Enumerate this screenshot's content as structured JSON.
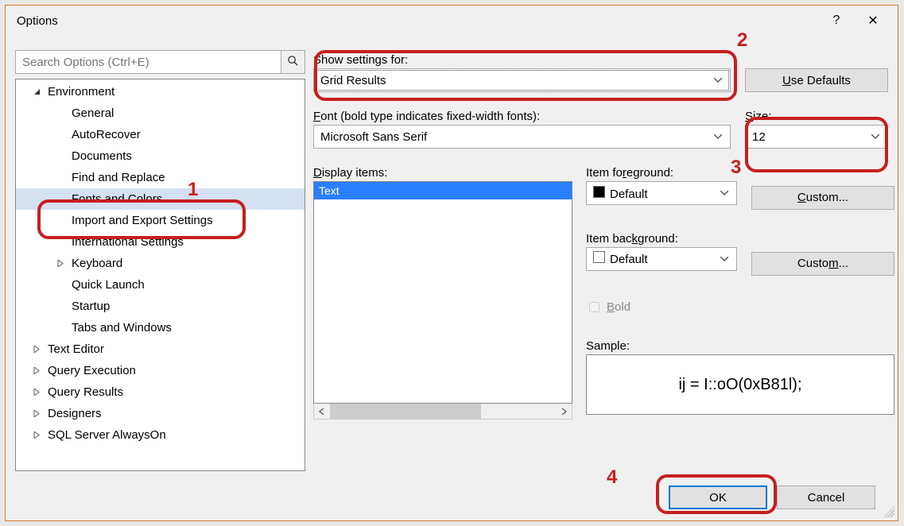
{
  "dialog": {
    "title": "Options",
    "help": "?",
    "close": "✕"
  },
  "search": {
    "placeholder": "Search Options (Ctrl+E)"
  },
  "tree": {
    "items": [
      {
        "label": "Environment",
        "depth": 0,
        "glyph": "▲",
        "expanded": true
      },
      {
        "label": "General",
        "depth": 1,
        "glyph": ""
      },
      {
        "label": "AutoRecover",
        "depth": 1,
        "glyph": ""
      },
      {
        "label": "Documents",
        "depth": 1,
        "glyph": ""
      },
      {
        "label": "Find and Replace",
        "depth": 1,
        "glyph": ""
      },
      {
        "label": "Fonts and Colors",
        "depth": 1,
        "glyph": "",
        "selected": true
      },
      {
        "label": "Import and Export Settings",
        "depth": 1,
        "glyph": ""
      },
      {
        "label": "International Settings",
        "depth": 1,
        "glyph": ""
      },
      {
        "label": "Keyboard",
        "depth": 1,
        "glyph": "▷"
      },
      {
        "label": "Quick Launch",
        "depth": 1,
        "glyph": ""
      },
      {
        "label": "Startup",
        "depth": 1,
        "glyph": ""
      },
      {
        "label": "Tabs and Windows",
        "depth": 1,
        "glyph": ""
      },
      {
        "label": "Text Editor",
        "depth": 0,
        "glyph": "▷"
      },
      {
        "label": "Query Execution",
        "depth": 0,
        "glyph": "▷"
      },
      {
        "label": "Query Results",
        "depth": 0,
        "glyph": "▷"
      },
      {
        "label": "Designers",
        "depth": 0,
        "glyph": "▷"
      },
      {
        "label": "SQL Server AlwaysOn",
        "depth": 0,
        "glyph": "▷"
      }
    ]
  },
  "right": {
    "show_settings_label": "Show settings for:",
    "show_settings_value": "Grid Results",
    "use_defaults": "Use Defaults",
    "use_defaults_accel": "U",
    "font_label": "Font (bold type indicates fixed-width fonts):",
    "font_label_accel": "F",
    "font_value": "Microsoft Sans Serif",
    "size_label": "Size:",
    "size_label_accel": "S",
    "size_value": "12",
    "display_items_label": "Display items:",
    "display_items_accel": "D",
    "display_items": [
      "Text"
    ],
    "item_fg_label": "Item foreground:",
    "item_fg_accel": "r",
    "item_fg_value": "Default",
    "custom_fg": "Custom...",
    "custom_fg_accel": "C",
    "item_bg_label": "Item background:",
    "item_bg_accel": "k",
    "item_bg_value": "Default",
    "custom_bg": "Custom...",
    "custom_bg_accel": "m",
    "bold_label": "Bold",
    "bold_accel": "B",
    "sample_label": "Sample:",
    "sample_text": "ij = I::oO(0xB81l);"
  },
  "footer": {
    "ok": "OK",
    "cancel": "Cancel"
  },
  "annotations": {
    "l1": "1",
    "l2": "2",
    "l3": "3",
    "l4": "4"
  }
}
